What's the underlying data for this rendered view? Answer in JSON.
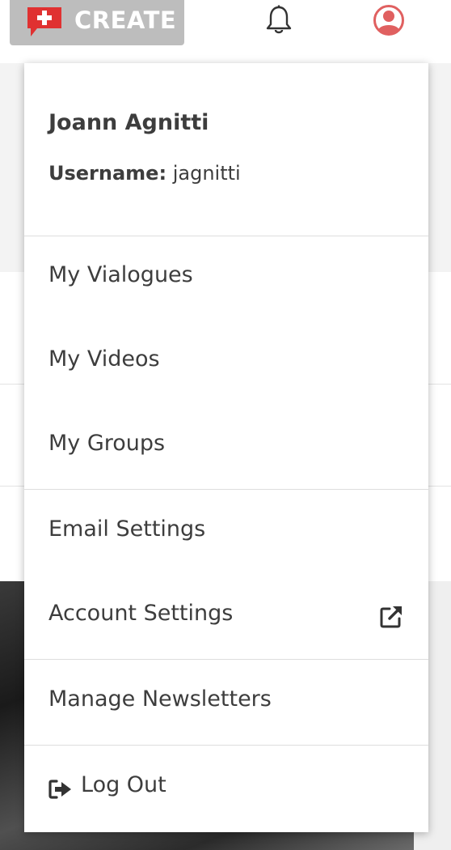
{
  "header": {
    "create_label": "CREATE",
    "icons": [
      "create-speech-plus-icon",
      "bell-icon",
      "user-circle-icon"
    ]
  },
  "user": {
    "name": "Joann Agnitti",
    "username_label": "Username:",
    "username_value": "jagnitti"
  },
  "menu": {
    "my_vialogues": "My Vialogues",
    "my_videos": "My Videos",
    "my_groups": "My Groups",
    "email_settings": "Email Settings",
    "account_settings": "Account Settings",
    "manage_newsletters": "Manage Newsletters",
    "log_out": "Log Out"
  },
  "colors": {
    "brand_red": "#e03131",
    "profile_red": "#e06060",
    "create_bg": "#bdbdbd",
    "text": "#3d3d3d"
  }
}
